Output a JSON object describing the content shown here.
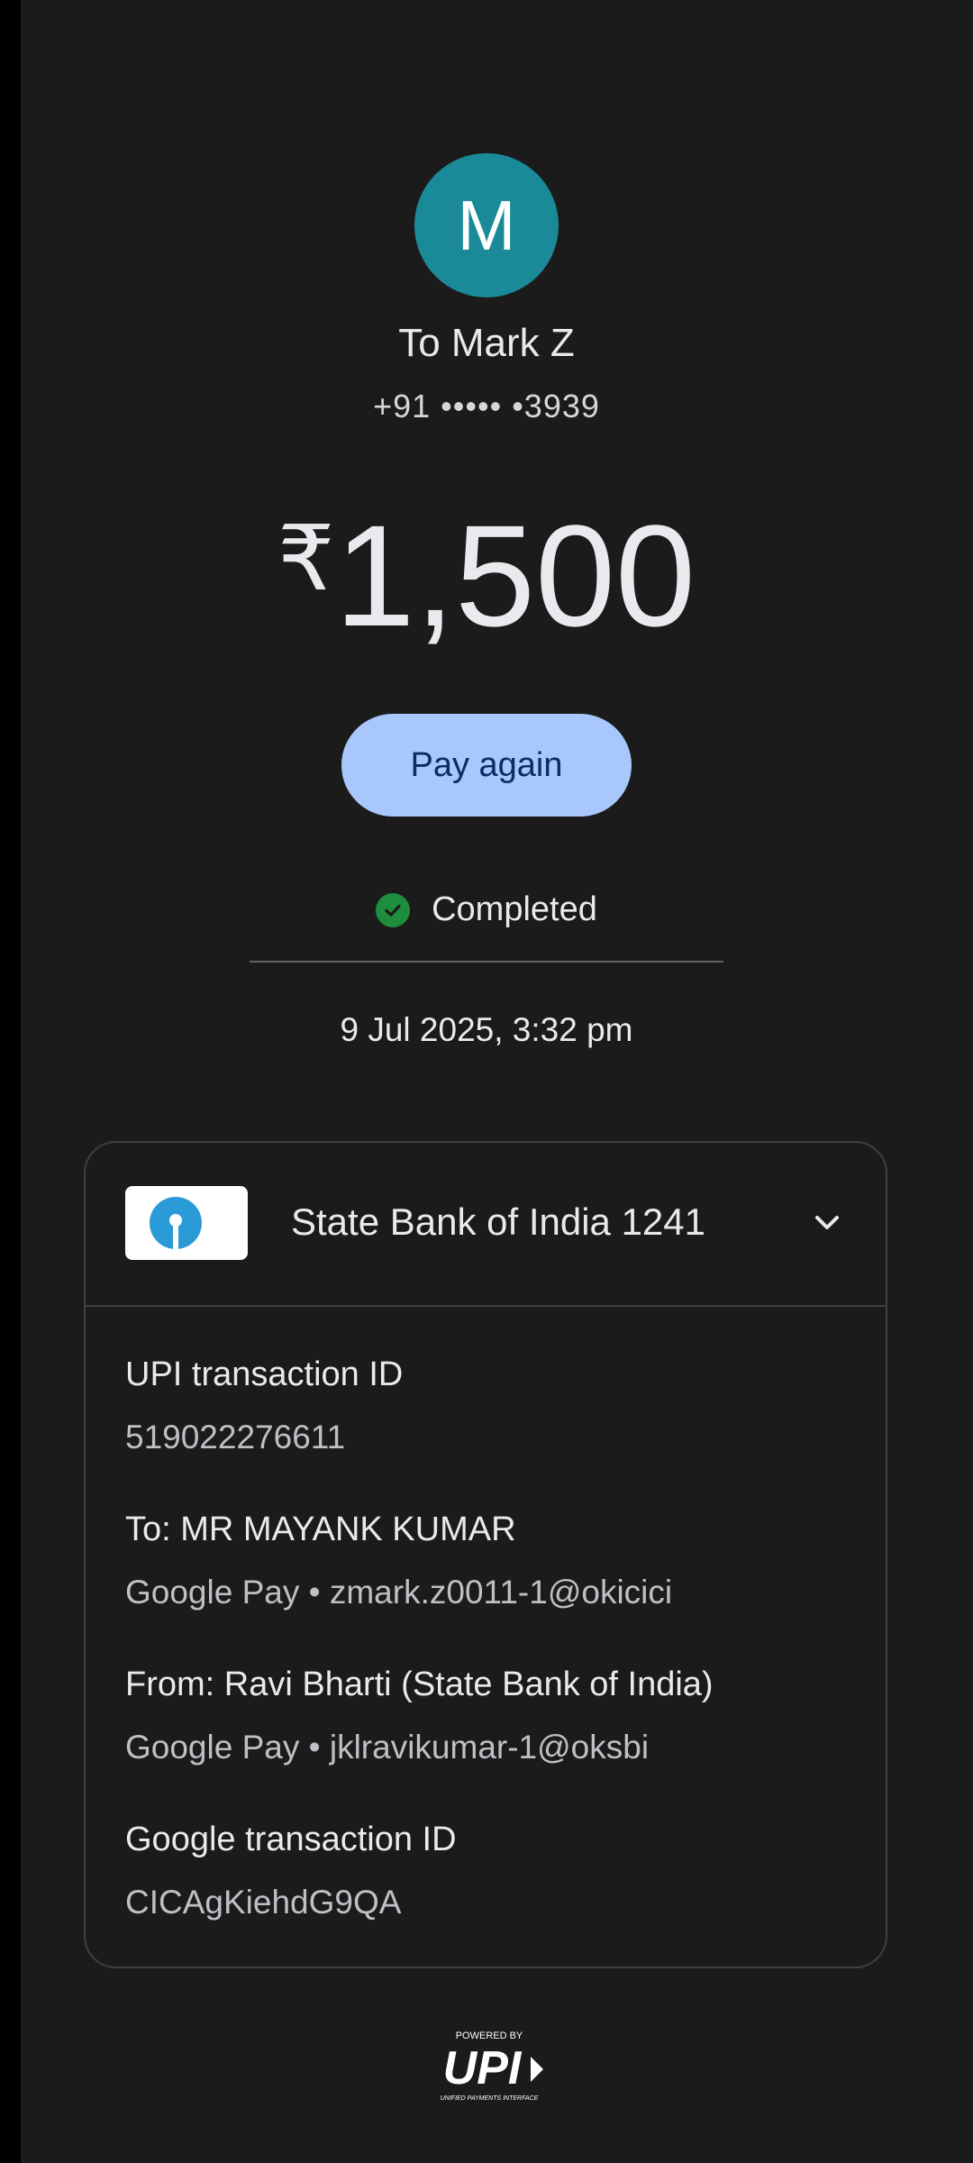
{
  "recipient": {
    "avatar_letter": "M",
    "name": "To Mark Z",
    "phone": "+91 ••••• •3939"
  },
  "amount": {
    "currency": "₹",
    "value": "1,500"
  },
  "actions": {
    "pay_again_label": "Pay again"
  },
  "status": {
    "text": "Completed",
    "color": "#1e8e3e"
  },
  "datetime": "9 Jul 2025, 3:32 pm",
  "card": {
    "bank_name": "State Bank of India 1241",
    "details": [
      {
        "label": "UPI transaction ID",
        "value": "519022276611"
      },
      {
        "label": "To: MR MAYANK  KUMAR",
        "value": "Google Pay • zmark.z0011-1@okicici"
      },
      {
        "label": "From: Ravi  Bharti (State Bank of India)",
        "value": "Google Pay • jklravikumar-1@oksbi"
      },
      {
        "label": "Google transaction ID",
        "value": "CICAgKiehdG9QA"
      }
    ]
  },
  "footer": {
    "powered_by": "POWERED BY",
    "upi_text": "UPI",
    "upi_subtitle": "UNIFIED PAYMENTS INTERFACE"
  },
  "icons": {
    "status": "check-circle-icon",
    "expand": "chevron-down-icon",
    "bank": "sbi-logo-icon"
  },
  "colors": {
    "background": "#1b1b1b",
    "avatar": "#1a8a98",
    "button": "#a8c7fa",
    "button_text": "#0b2c66"
  }
}
